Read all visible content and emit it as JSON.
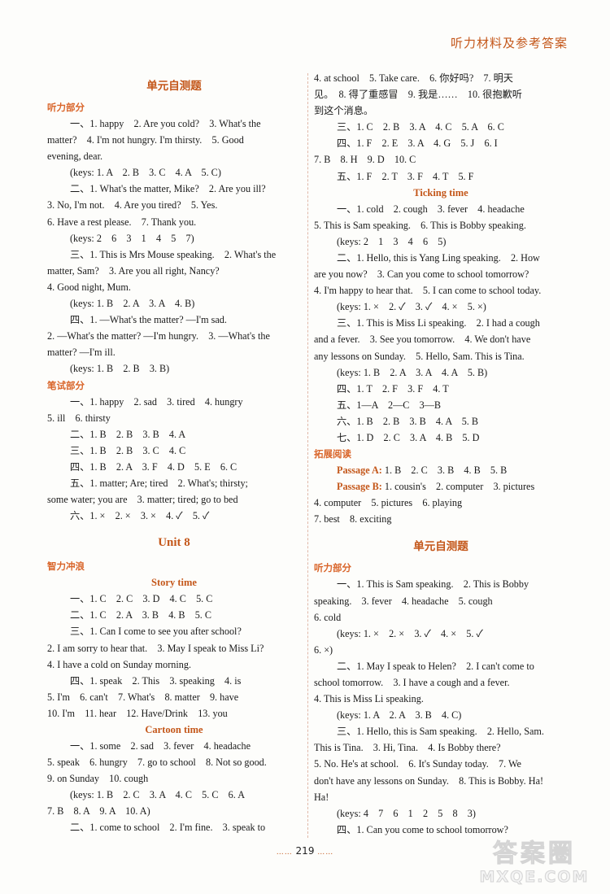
{
  "header": {
    "running_title": "听力材料及参考答案"
  },
  "left_column": {
    "section_title": "单元自测题",
    "listening_part": {
      "title": "听力部分",
      "q1": [
        "一、1. happy　2. Are you cold?　3. What's the",
        "matter?　4. I'm not hungry. I'm thirsty.　5. Good",
        "evening, dear.",
        "(keys: 1. A　2. B　3. C　4. A　5. C)"
      ],
      "q2": [
        "二、1. What's the matter, Mike?　2. Are you ill?",
        "3. No, I'm not.　4. Are you tired?　5. Yes.",
        "6. Have a rest please.　7. Thank you.",
        "(keys: 2　6　3　1　4　5　7)"
      ],
      "q3": [
        "三、1. This is Mrs Mouse speaking.　2. What's the",
        "matter, Sam?　3. Are you all right, Nancy?",
        "4. Good night, Mum.",
        "(keys: 1. B　2. A　3. A　4. B)"
      ],
      "q4": [
        "四、1. —What's the matter? —I'm sad.",
        "2. —What's the matter? —I'm hungry.　3. —What's the",
        "matter? —I'm ill.",
        "(keys: 1. B　2. B　3. B)"
      ]
    },
    "written_part": {
      "title": "笔试部分",
      "lines": [
        "一、1. happy　2. sad　3. tired　4. hungry",
        "5. ill　6. thirsty",
        "二、1. B　2. B　3. B　4. A",
        "三、1. B　2. B　3. C　4. C",
        "四、1. B　2. A　3. F　4. D　5. E　6. C",
        "五、1. matter; Are; tired　2. What's; thirsty;",
        "some water; you are　3. matter; tired; go to bed",
        "六、1. ×　2. ×　3. ×　4. ✓　5. ✓"
      ]
    },
    "unit_title": "Unit 8",
    "brain_part": {
      "title": "智力冲浪",
      "story_time": {
        "title": "Story time",
        "lines": [
          "一、1. C　2. C　3. D　4. C　5. C",
          "二、1. C　2. A　3. B　4. B　5. C",
          "三、1. Can I come to see you after school?",
          "2. I am sorry to hear that.　3. May I speak to Miss Li?",
          "4. I have a cold on Sunday morning.",
          "四、1. speak　2. This　3. speaking　4. is",
          "5. I'm　6. can't　7. What's　8. matter　9. have",
          "10. I'm　11. hear　12. Have/Drink　13. you"
        ]
      },
      "cartoon_time": {
        "title": "Cartoon time",
        "lines": [
          "一、1. some　2. sad　3. fever　4. headache",
          "5. speak　6. hungry　7. go to school　8. Not so good.",
          "9. on Sunday　10. cough",
          "(keys: 1. B　2. C　3. A　4. C　5. C　6. A",
          "7. B　8. A　9. A　10. A)",
          "二、1. come to school　2. I'm fine.　3. speak to"
        ]
      }
    }
  },
  "right_column": {
    "continued_lines": [
      "4. at school　5. Take care.　6. 你好吗?　7. 明天",
      "见。　8. 得了重感冒　9. 我是……　10. 很抱歉听",
      "到这个消息。",
      "三、1. C　2. B　3. A　4. C　5. A　6. C",
      "四、1. F　2. E　3. A　4. G　5. J　6. I",
      "7. B　8. H　9. D　10. C",
      "五、1. F　2. T　3. F　4. T　5. F"
    ],
    "ticking_time": {
      "title": "Ticking time",
      "lines": [
        "一、1. cold　2. cough　3. fever　4. headache",
        "5. This is Sam speaking.　6. This is Bobby speaking.",
        "(keys: 2　1　3　4　6　5)",
        "二、1. Hello, this is Yang Ling speaking.　2. How",
        "are you now?　3. Can you come to school tomorrow?",
        "4. I'm happy to hear that.　5. I can come to school today.",
        "(keys: 1. ×　2. ✓　3. ✓　4. ×　5. ×)",
        "三、1. This is Miss Li speaking.　2. I had a cough",
        "and a fever.　3. See you tomorrow.　4. We don't have",
        "any lessons on Sunday.　5. Hello, Sam. This is Tina.",
        "(keys: 1. B　2. A　3. A　4. A　5. B)",
        "四、1. T　2. F　3. F　4. T",
        "五、1—A　2—C　3—B",
        "六、1. B　2. B　3. B　4. A　5. B",
        "七、1. D　2. C　3. A　4. B　5. D"
      ]
    },
    "extended_reading": {
      "title": "拓展阅读",
      "passage_a_label": "Passage A:",
      "passage_a": " 1. B　2. C　3. B　4. B　5. B",
      "passage_b_label": "Passage B:",
      "passage_b": " 1. cousin's　2. computer　3. pictures",
      "passage_b_cont": [
        "4. computer　5. pictures　6. playing",
        "7. best　8. exciting"
      ]
    },
    "section_title": "单元自测题",
    "listening_part": {
      "title": "听力部分",
      "lines": [
        {
          "t": "一、1. This is Sam speaking.　2. This is Bobby",
          "i": true
        },
        {
          "t": "speaking.　3. fever　4. headache　5. cough",
          "i": false
        },
        {
          "t": "6. cold",
          "i": false
        },
        {
          "t": "(keys: 1. ×　2. ×　3. ✓　4. ×　5. ✓",
          "i": true
        },
        {
          "t": "6. ×)",
          "i": false
        },
        {
          "t": "二、1. May I speak to Helen?　2. I can't come to",
          "i": true
        },
        {
          "t": "school tomorrow.　3. I have a cough and a fever.",
          "i": false
        },
        {
          "t": "4. This is Miss Li speaking.",
          "i": false
        },
        {
          "t": "(keys: 1. A　2. A　3. B　4. C)",
          "i": true
        },
        {
          "t": "三、1. Hello, this is Sam speaking.　2. Hello, Sam.",
          "i": true
        },
        {
          "t": "This is Tina.　3. Hi, Tina.　4. Is Bobby there?",
          "i": false
        },
        {
          "t": "5. No. He's at school.　6. It's Sunday today.　7. We",
          "i": false
        },
        {
          "t": "don't have any lessons on Sunday.　8. This is Bobby. Ha!",
          "i": false
        },
        {
          "t": "Ha!",
          "i": false
        },
        {
          "t": "(keys: 4　7　6　1　2　5　8　3)",
          "i": true
        },
        {
          "t": "四、1. Can you come to school tomorrow?",
          "i": true
        }
      ]
    }
  },
  "footer": {
    "page_number": "219",
    "dots": "……"
  },
  "watermark": {
    "line1": "答案圈",
    "line2": "MXQE.COM"
  }
}
